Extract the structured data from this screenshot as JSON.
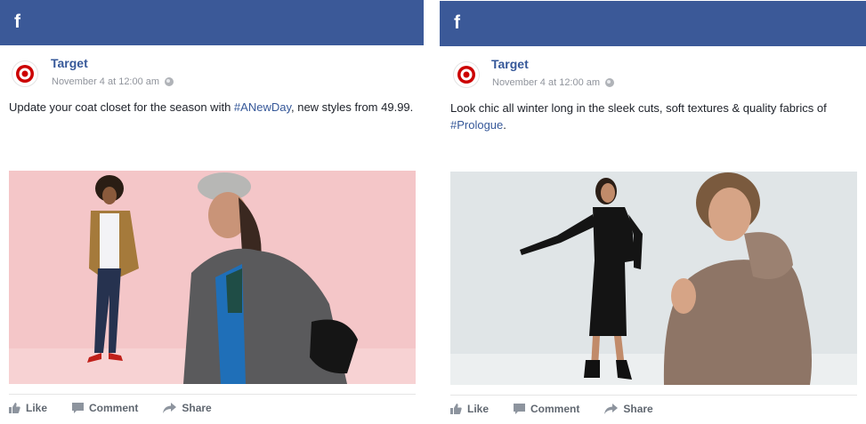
{
  "posts": [
    {
      "network_logo": "f",
      "page_name": "Target",
      "timestamp": "November 4 at 12:00 am",
      "privacy_icon": "globe-icon",
      "text_prefix": "Update your coat closet for the season with ",
      "hashtag": "#ANewDay",
      "text_suffix": ", new styles from 49.99.",
      "actions": {
        "like": "Like",
        "comment": "Comment",
        "share": "Share"
      }
    },
    {
      "network_logo": "f",
      "page_name": "Target",
      "timestamp": "November 4 at 12:00 am",
      "privacy_icon": "globe-icon",
      "text_prefix": "Look chic all winter long in the sleek cuts, soft textures & quality fabrics of ",
      "hashtag": "#Prologue",
      "text_suffix": ".",
      "actions": {
        "like": "Like",
        "comment": "Comment",
        "share": "Share"
      }
    }
  ],
  "colors": {
    "facebook_blue": "#3b5998",
    "link_blue": "#365899",
    "target_red": "#cc0000",
    "meta_gray": "#90949c"
  }
}
